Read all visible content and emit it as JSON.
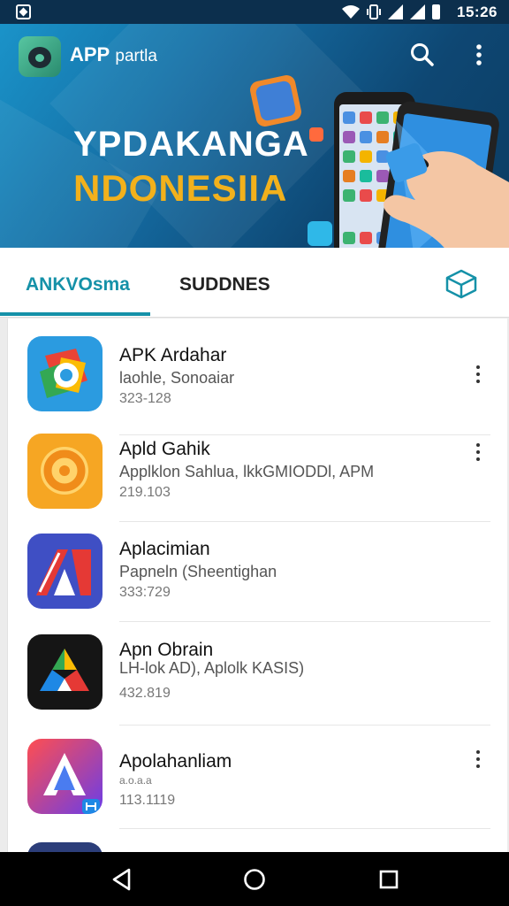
{
  "status_bar": {
    "time": "15:26"
  },
  "header": {
    "app_name_bold": "APP",
    "app_name_rest": "partla",
    "search_icon": "search-icon",
    "menu_icon": "more-vert-icon"
  },
  "banner": {
    "headline_line1": "YPDAKANGA",
    "headline_line2": "NDONESIIA"
  },
  "tabs": {
    "tab1": "ANKVOsma",
    "tab2": "SUDDNES",
    "action_icon": "box-icon"
  },
  "apps": [
    {
      "title": "APK Ardahar",
      "subtitle": "laohle, Sonoaiar",
      "meta": "323-128"
    },
    {
      "title": "Apld Gahik",
      "subtitle": "Applklon Sahlua, lkkGMIODDl, APM",
      "meta": "219.103"
    },
    {
      "title": "Aplacimian",
      "subtitle": "Papneln (Sheentighan",
      "meta": "333:729"
    },
    {
      "title": "Apn Obrain",
      "subtitle": "LH-lok AD), Aplolk KASIS)",
      "meta": "432.819"
    },
    {
      "title": "Apolahanliam",
      "subtitle": "a.o.a.a",
      "meta": "113.1119"
    }
  ],
  "colors": {
    "accent": "#1591a8",
    "banner": "#146aa0",
    "headline_gold": "#f2b11c"
  }
}
